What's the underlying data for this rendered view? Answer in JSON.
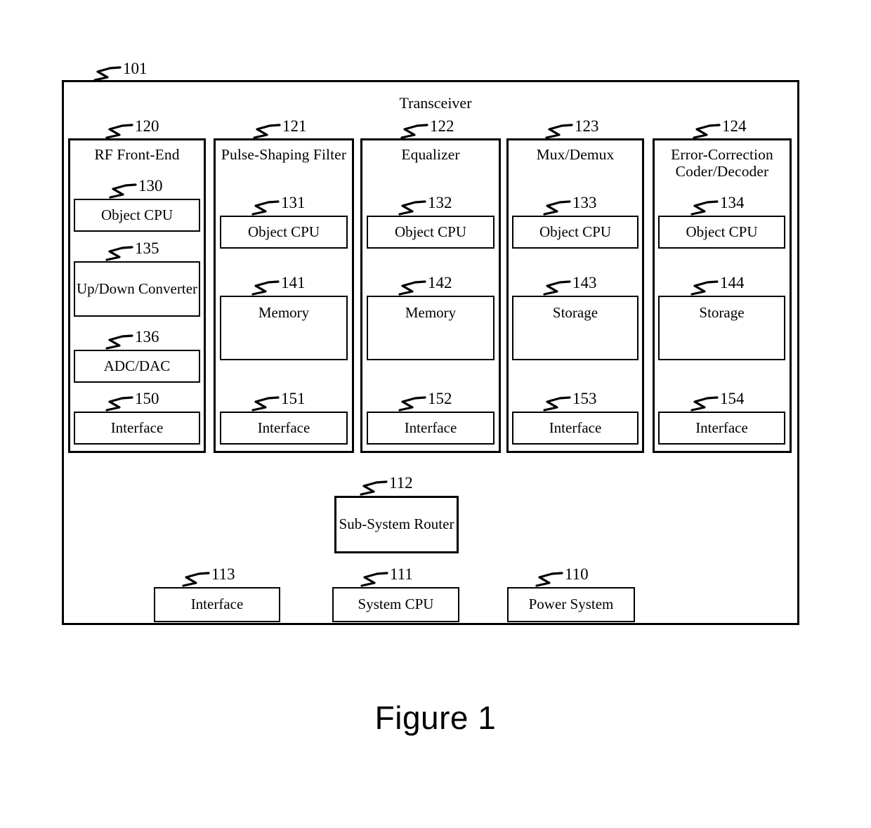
{
  "figure": {
    "caption": "Figure 1",
    "root_ref": "101",
    "transceiver_title": "Transceiver"
  },
  "columns": [
    {
      "ref": "120",
      "title": "RF Front-End",
      "blocks": [
        {
          "ref": "130",
          "label": "Object CPU"
        },
        {
          "ref": "135",
          "label": "Up/Down Converter"
        },
        {
          "ref": "136",
          "label": "ADC/DAC"
        },
        {
          "ref": "150",
          "label": "Interface"
        }
      ]
    },
    {
      "ref": "121",
      "title": "Pulse-Shaping Filter",
      "blocks": [
        {
          "ref": "131",
          "label": "Object CPU"
        },
        {
          "ref": "141",
          "label": "Memory"
        },
        {
          "ref": "151",
          "label": "Interface"
        }
      ]
    },
    {
      "ref": "122",
      "title": "Equalizer",
      "blocks": [
        {
          "ref": "132",
          "label": "Object CPU"
        },
        {
          "ref": "142",
          "label": "Memory"
        },
        {
          "ref": "152",
          "label": "Interface"
        }
      ]
    },
    {
      "ref": "123",
      "title": "Mux/Demux",
      "blocks": [
        {
          "ref": "133",
          "label": "Object CPU"
        },
        {
          "ref": "143",
          "label": "Storage"
        },
        {
          "ref": "153",
          "label": "Interface"
        }
      ]
    },
    {
      "ref": "124",
      "title": "Error-Correction Coder/Decoder",
      "blocks": [
        {
          "ref": "134",
          "label": "Object CPU"
        },
        {
          "ref": "144",
          "label": "Storage"
        },
        {
          "ref": "154",
          "label": "Interface"
        }
      ]
    }
  ],
  "bottom": {
    "router": {
      "ref": "112",
      "label": "Sub-System Router"
    },
    "interface": {
      "ref": "113",
      "label": "Interface"
    },
    "system_cpu": {
      "ref": "111",
      "label": "System CPU"
    },
    "power_system": {
      "ref": "110",
      "label": "Power System"
    }
  },
  "colors": {
    "line": "#000000",
    "background": "#ffffff"
  }
}
